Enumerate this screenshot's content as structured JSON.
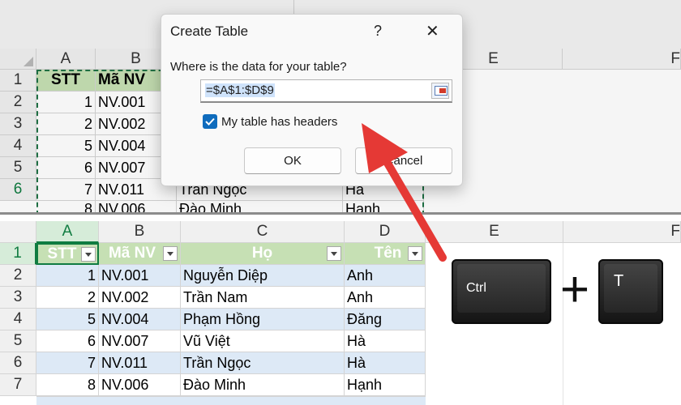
{
  "top_sheet": {
    "col_headers": [
      "A",
      "B",
      "E",
      "F"
    ],
    "row_headers": [
      "1",
      "2",
      "3",
      "4",
      "5",
      "6",
      "7"
    ],
    "header_row": [
      "STT",
      "Mã NV"
    ],
    "rows": [
      [
        "1",
        "NV.001"
      ],
      [
        "2",
        "NV.002"
      ],
      [
        "5",
        "NV.004"
      ],
      [
        "6",
        "NV.007"
      ],
      [
        "7",
        "NV.011",
        "Trần Ngọc",
        "Hà"
      ],
      [
        "8",
        "NV.006",
        "Đào Minh",
        "Hạnh"
      ]
    ]
  },
  "dialog": {
    "title": "Create Table",
    "help": "?",
    "close": "✕",
    "prompt": "Where is the data for your table?",
    "range_value": "=$A$1:$D$9",
    "checkbox_label": "My table has headers",
    "checkbox_checked": true,
    "ok_label": "OK",
    "cancel_label": "Cancel"
  },
  "bottom_sheet": {
    "col_headers": [
      "A",
      "B",
      "C",
      "D",
      "E",
      "F"
    ],
    "row_headers": [
      "1",
      "2",
      "3",
      "4",
      "5",
      "6",
      "7"
    ],
    "table_headers": [
      "STT",
      "Mã NV",
      "Họ",
      "Tên"
    ],
    "rows": [
      [
        "1",
        "NV.001",
        "Nguyễn Diệp",
        "Anh"
      ],
      [
        "2",
        "NV.002",
        "Trần Nam",
        "Anh"
      ],
      [
        "5",
        "NV.004",
        "Phạm Hồng",
        "Đăng"
      ],
      [
        "6",
        "NV.007",
        "Vũ Việt",
        "Hà"
      ],
      [
        "7",
        "NV.011",
        "Trần Ngọc",
        "Hà"
      ],
      [
        "8",
        "NV.006",
        "Đào Minh",
        "Hạnh"
      ]
    ]
  },
  "shortcut": {
    "key1": "Ctrl",
    "plus": "+",
    "key2": "T"
  },
  "colors": {
    "header_green": "#c6e0b4",
    "row_blue": "#dde9f6",
    "arrow_red": "#e53935",
    "accent_blue": "#0f6cbd"
  }
}
